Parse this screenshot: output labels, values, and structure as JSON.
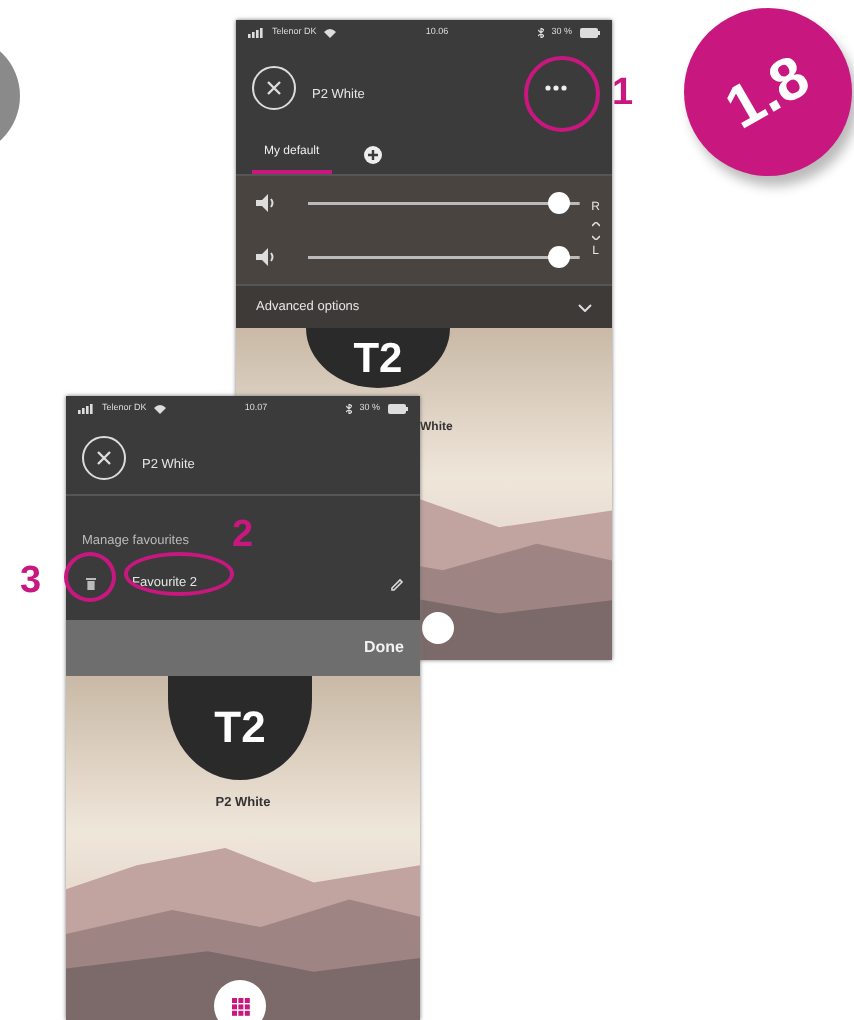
{
  "back_screen": {
    "status_bar": {
      "carrier": "Telenor DK",
      "time": "10.06",
      "battery": "30 %"
    },
    "title": "P2 White",
    "tabs": [
      {
        "label": "My default",
        "selected": true
      }
    ],
    "sliders": [
      {
        "level": 0.92
      },
      {
        "level": 0.92
      }
    ],
    "channel_labels": [
      "R",
      "L"
    ],
    "advanced_options": "Advanced options",
    "device_badge": "T2",
    "device_name": "White"
  },
  "front_screen": {
    "status_bar": {
      "carrier": "Telenor DK",
      "time": "10.07",
      "battery": "30 %"
    },
    "title": "P2 White",
    "section_title": "Manage favourites",
    "favourites": [
      {
        "name": "Favourite 2"
      }
    ],
    "done_button": "Done",
    "device_badge": "T2",
    "device_name": "P2 White"
  },
  "callouts": [
    {
      "label": "1"
    },
    {
      "label": "2"
    },
    {
      "label": "3"
    }
  ],
  "step_badge": "1.8"
}
